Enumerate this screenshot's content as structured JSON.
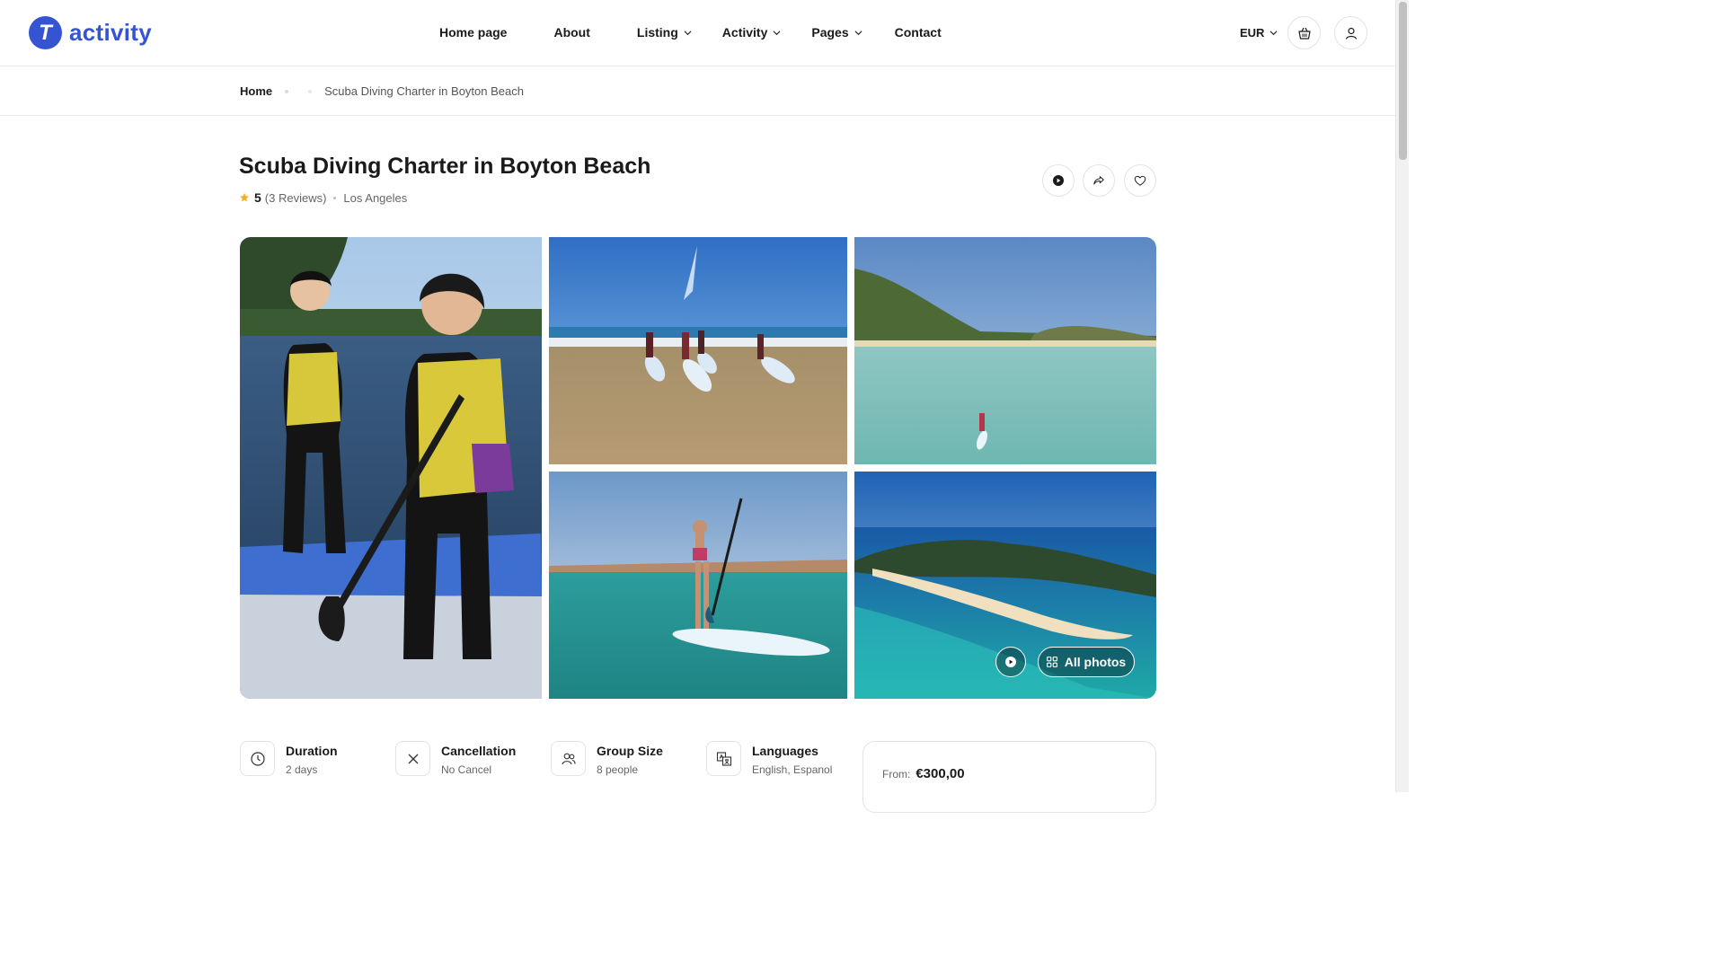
{
  "header": {
    "brand": "activity",
    "logo_letter": "T",
    "nav": [
      {
        "label": "Home page",
        "dropdown": false
      },
      {
        "label": "About",
        "dropdown": false
      },
      {
        "label": "Listing",
        "dropdown": true
      },
      {
        "label": "Activity",
        "dropdown": true
      },
      {
        "label": "Pages",
        "dropdown": true
      },
      {
        "label": "Contact",
        "dropdown": false
      }
    ],
    "currency": "EUR",
    "accent_color": "#3554d1"
  },
  "breadcrumb": {
    "home": "Home",
    "current": "Scuba Diving Charter in Boyton Beach"
  },
  "listing": {
    "title": "Scuba Diving Charter in Boyton Beach",
    "rating": "5",
    "reviews": "(3 Reviews)",
    "location": "Los Angeles",
    "star_color": "#f2b01e"
  },
  "gallery": {
    "all_photos_label": "All photos",
    "images": [
      "paddleboard-pair",
      "beach-surfboards",
      "bay-aerial",
      "paddleboard-woman",
      "island-aerial"
    ]
  },
  "facts": [
    {
      "icon": "clock-icon",
      "label": "Duration",
      "value": "2 days"
    },
    {
      "icon": "x-icon",
      "label": "Cancellation",
      "value": "No Cancel"
    },
    {
      "icon": "users-icon",
      "label": "Group Size",
      "value": "8 people"
    },
    {
      "icon": "translate-icon",
      "label": "Languages",
      "value": "English, Espanol"
    }
  ],
  "booking": {
    "from_label": "From:",
    "price": "€300,00"
  }
}
